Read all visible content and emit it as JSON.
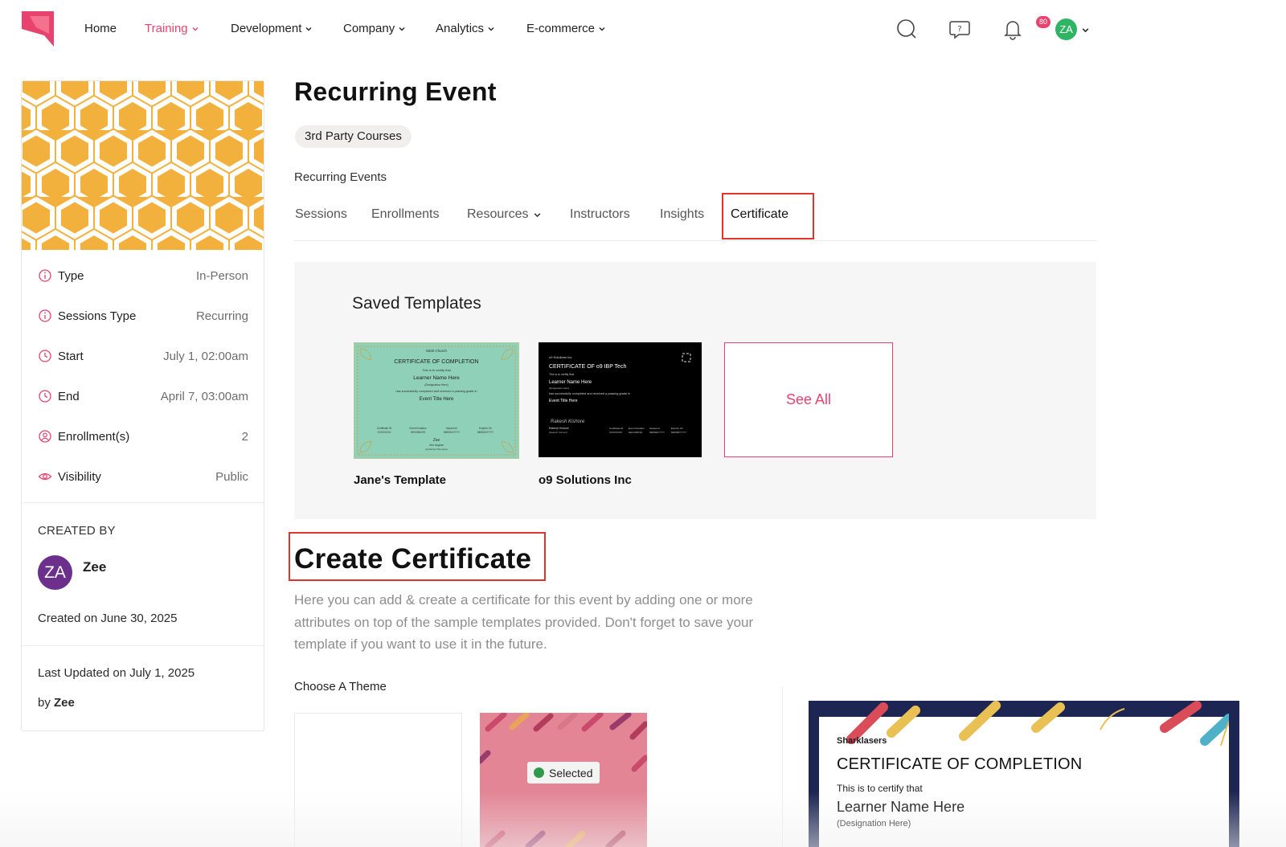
{
  "nav": {
    "items": [
      {
        "label": "Home",
        "active": false,
        "dropdown": false
      },
      {
        "label": "Training",
        "active": true,
        "dropdown": true
      },
      {
        "label": "Development",
        "active": false,
        "dropdown": true
      },
      {
        "label": "Company",
        "active": false,
        "dropdown": true
      },
      {
        "label": "Analytics",
        "active": false,
        "dropdown": true
      },
      {
        "label": "E-commerce",
        "active": false,
        "dropdown": true
      }
    ],
    "notification_count": "80",
    "user_initials": "ZA",
    "icons": [
      "search-icon",
      "help-chat-icon",
      "bell-icon",
      "chevron-down-icon"
    ],
    "accent_color": "#e8436e"
  },
  "sidebar": {
    "details": [
      {
        "label": "Type",
        "value": "In-Person",
        "icon": "info-icon"
      },
      {
        "label": "Sessions Type",
        "value": "Recurring",
        "icon": "info-icon"
      },
      {
        "label": "Start",
        "value": "July 1, 02:00am",
        "icon": "clock-icon"
      },
      {
        "label": "End",
        "value": "April 7, 03:00am",
        "icon": "clock-icon"
      },
      {
        "label": "Enrollment(s)",
        "value": "2",
        "icon": "user-icon"
      },
      {
        "label": "Visibility",
        "value": "Public",
        "icon": "eye-icon"
      }
    ],
    "created_by_heading": "CREATED BY",
    "creator_initials": "ZA",
    "creator_name": "Zee",
    "created_on": "Created on June 30, 2025",
    "updated_on": "Last Updated on July 1, 2025",
    "updated_by_prefix": "by",
    "updated_by_name": "Zee",
    "hero_color": "#f2b13d"
  },
  "main": {
    "title": "Recurring Event",
    "category_chip": "3rd Party Courses",
    "subcategory": "Recurring Events",
    "tabs": [
      {
        "label": "Sessions",
        "active": false
      },
      {
        "label": "Enrollments",
        "active": false
      },
      {
        "label": "Resources",
        "active": false,
        "dropdown": true
      },
      {
        "label": "Instructors",
        "active": false
      },
      {
        "label": "Insights",
        "active": false
      },
      {
        "label": "Certificate",
        "active": true
      }
    ],
    "saved_templates": {
      "heading": "Saved Templates",
      "templates": [
        {
          "name": "Jane's Template",
          "org": "6500 Church",
          "title": "CERTIFICATE OF COMPLETION",
          "certify": "This is to certify that",
          "learner": "Learner Name Here",
          "designation": "(Designation Here)",
          "completed": "has successfully completed and received a passing grade in",
          "event": "Event Title Here",
          "signature": "Zee",
          "signer": "Zee Asghar",
          "signer_role": "(Authority Title Here)",
          "background": "#8fd0b8"
        },
        {
          "name": "o9 Solutions Inc",
          "org": "o9 Solutions Inc",
          "title": "CERTIFICATE OF o9 IBP Tech",
          "certify": "This is to certify that",
          "learner": "Learner Name Here",
          "designation": "(Designation Here)",
          "completed": "has successfully completed and received a passing grade in",
          "event": "Event Title Here",
          "signature": "Rakesh Kishore",
          "signer": "Rakesh Kishore",
          "signer_role": "(Rakesh Kishore)",
          "background": "#000000"
        }
      ],
      "see_all": "See All",
      "footer_fields": [
        {
          "label": "Certificate ID",
          "value": "XXXXXXXX"
        },
        {
          "label": "Event Duration",
          "value": "HHH:MM:SS"
        },
        {
          "label": "Issued on",
          "value": "MM/DD/YYYY"
        },
        {
          "label": "Expires On",
          "value": "MM/DD/YYYY"
        }
      ]
    },
    "create": {
      "title": "Create Certificate",
      "description": "Here you can add & create a certificate for this event by adding one or more attributes on top of the sample templates provided. Don't forget to save your template if you want to use it in the future.",
      "choose_theme": "Choose A Theme",
      "selected_label": "Selected"
    },
    "preview": {
      "brand": "Sharklasers",
      "title": "CERTIFICATE OF COMPLETION",
      "certify": "This is to certify that",
      "learner": "Learner Name Here",
      "designation": "(Designation Here)"
    }
  }
}
